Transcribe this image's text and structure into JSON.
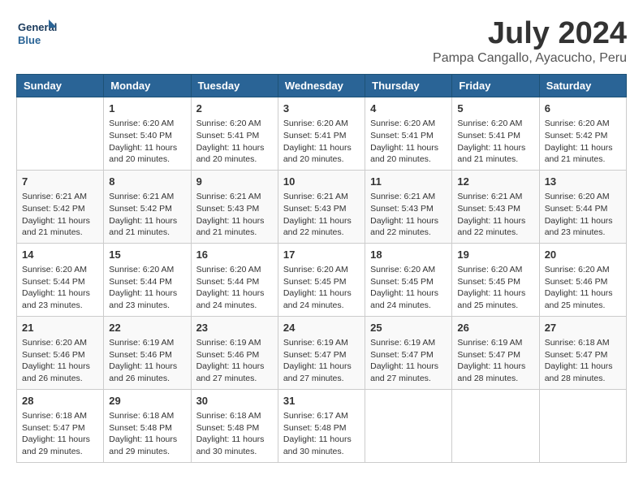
{
  "logo": {
    "line1": "General",
    "line2": "Blue"
  },
  "title": "July 2024",
  "subtitle": "Pampa Cangallo, Ayacucho, Peru",
  "days_of_week": [
    "Sunday",
    "Monday",
    "Tuesday",
    "Wednesday",
    "Thursday",
    "Friday",
    "Saturday"
  ],
  "weeks": [
    [
      {
        "day": "",
        "sunrise": "",
        "sunset": "",
        "daylight": ""
      },
      {
        "day": "1",
        "sunrise": "Sunrise: 6:20 AM",
        "sunset": "Sunset: 5:40 PM",
        "daylight": "Daylight: 11 hours and 20 minutes."
      },
      {
        "day": "2",
        "sunrise": "Sunrise: 6:20 AM",
        "sunset": "Sunset: 5:41 PM",
        "daylight": "Daylight: 11 hours and 20 minutes."
      },
      {
        "day": "3",
        "sunrise": "Sunrise: 6:20 AM",
        "sunset": "Sunset: 5:41 PM",
        "daylight": "Daylight: 11 hours and 20 minutes."
      },
      {
        "day": "4",
        "sunrise": "Sunrise: 6:20 AM",
        "sunset": "Sunset: 5:41 PM",
        "daylight": "Daylight: 11 hours and 20 minutes."
      },
      {
        "day": "5",
        "sunrise": "Sunrise: 6:20 AM",
        "sunset": "Sunset: 5:41 PM",
        "daylight": "Daylight: 11 hours and 21 minutes."
      },
      {
        "day": "6",
        "sunrise": "Sunrise: 6:20 AM",
        "sunset": "Sunset: 5:42 PM",
        "daylight": "Daylight: 11 hours and 21 minutes."
      }
    ],
    [
      {
        "day": "7",
        "sunrise": "Sunrise: 6:21 AM",
        "sunset": "Sunset: 5:42 PM",
        "daylight": "Daylight: 11 hours and 21 minutes."
      },
      {
        "day": "8",
        "sunrise": "Sunrise: 6:21 AM",
        "sunset": "Sunset: 5:42 PM",
        "daylight": "Daylight: 11 hours and 21 minutes."
      },
      {
        "day": "9",
        "sunrise": "Sunrise: 6:21 AM",
        "sunset": "Sunset: 5:43 PM",
        "daylight": "Daylight: 11 hours and 21 minutes."
      },
      {
        "day": "10",
        "sunrise": "Sunrise: 6:21 AM",
        "sunset": "Sunset: 5:43 PM",
        "daylight": "Daylight: 11 hours and 22 minutes."
      },
      {
        "day": "11",
        "sunrise": "Sunrise: 6:21 AM",
        "sunset": "Sunset: 5:43 PM",
        "daylight": "Daylight: 11 hours and 22 minutes."
      },
      {
        "day": "12",
        "sunrise": "Sunrise: 6:21 AM",
        "sunset": "Sunset: 5:43 PM",
        "daylight": "Daylight: 11 hours and 22 minutes."
      },
      {
        "day": "13",
        "sunrise": "Sunrise: 6:20 AM",
        "sunset": "Sunset: 5:44 PM",
        "daylight": "Daylight: 11 hours and 23 minutes."
      }
    ],
    [
      {
        "day": "14",
        "sunrise": "Sunrise: 6:20 AM",
        "sunset": "Sunset: 5:44 PM",
        "daylight": "Daylight: 11 hours and 23 minutes."
      },
      {
        "day": "15",
        "sunrise": "Sunrise: 6:20 AM",
        "sunset": "Sunset: 5:44 PM",
        "daylight": "Daylight: 11 hours and 23 minutes."
      },
      {
        "day": "16",
        "sunrise": "Sunrise: 6:20 AM",
        "sunset": "Sunset: 5:44 PM",
        "daylight": "Daylight: 11 hours and 24 minutes."
      },
      {
        "day": "17",
        "sunrise": "Sunrise: 6:20 AM",
        "sunset": "Sunset: 5:45 PM",
        "daylight": "Daylight: 11 hours and 24 minutes."
      },
      {
        "day": "18",
        "sunrise": "Sunrise: 6:20 AM",
        "sunset": "Sunset: 5:45 PM",
        "daylight": "Daylight: 11 hours and 24 minutes."
      },
      {
        "day": "19",
        "sunrise": "Sunrise: 6:20 AM",
        "sunset": "Sunset: 5:45 PM",
        "daylight": "Daylight: 11 hours and 25 minutes."
      },
      {
        "day": "20",
        "sunrise": "Sunrise: 6:20 AM",
        "sunset": "Sunset: 5:46 PM",
        "daylight": "Daylight: 11 hours and 25 minutes."
      }
    ],
    [
      {
        "day": "21",
        "sunrise": "Sunrise: 6:20 AM",
        "sunset": "Sunset: 5:46 PM",
        "daylight": "Daylight: 11 hours and 26 minutes."
      },
      {
        "day": "22",
        "sunrise": "Sunrise: 6:19 AM",
        "sunset": "Sunset: 5:46 PM",
        "daylight": "Daylight: 11 hours and 26 minutes."
      },
      {
        "day": "23",
        "sunrise": "Sunrise: 6:19 AM",
        "sunset": "Sunset: 5:46 PM",
        "daylight": "Daylight: 11 hours and 27 minutes."
      },
      {
        "day": "24",
        "sunrise": "Sunrise: 6:19 AM",
        "sunset": "Sunset: 5:47 PM",
        "daylight": "Daylight: 11 hours and 27 minutes."
      },
      {
        "day": "25",
        "sunrise": "Sunrise: 6:19 AM",
        "sunset": "Sunset: 5:47 PM",
        "daylight": "Daylight: 11 hours and 27 minutes."
      },
      {
        "day": "26",
        "sunrise": "Sunrise: 6:19 AM",
        "sunset": "Sunset: 5:47 PM",
        "daylight": "Daylight: 11 hours and 28 minutes."
      },
      {
        "day": "27",
        "sunrise": "Sunrise: 6:18 AM",
        "sunset": "Sunset: 5:47 PM",
        "daylight": "Daylight: 11 hours and 28 minutes."
      }
    ],
    [
      {
        "day": "28",
        "sunrise": "Sunrise: 6:18 AM",
        "sunset": "Sunset: 5:47 PM",
        "daylight": "Daylight: 11 hours and 29 minutes."
      },
      {
        "day": "29",
        "sunrise": "Sunrise: 6:18 AM",
        "sunset": "Sunset: 5:48 PM",
        "daylight": "Daylight: 11 hours and 29 minutes."
      },
      {
        "day": "30",
        "sunrise": "Sunrise: 6:18 AM",
        "sunset": "Sunset: 5:48 PM",
        "daylight": "Daylight: 11 hours and 30 minutes."
      },
      {
        "day": "31",
        "sunrise": "Sunrise: 6:17 AM",
        "sunset": "Sunset: 5:48 PM",
        "daylight": "Daylight: 11 hours and 30 minutes."
      },
      {
        "day": "",
        "sunrise": "",
        "sunset": "",
        "daylight": ""
      },
      {
        "day": "",
        "sunrise": "",
        "sunset": "",
        "daylight": ""
      },
      {
        "day": "",
        "sunrise": "",
        "sunset": "",
        "daylight": ""
      }
    ]
  ]
}
